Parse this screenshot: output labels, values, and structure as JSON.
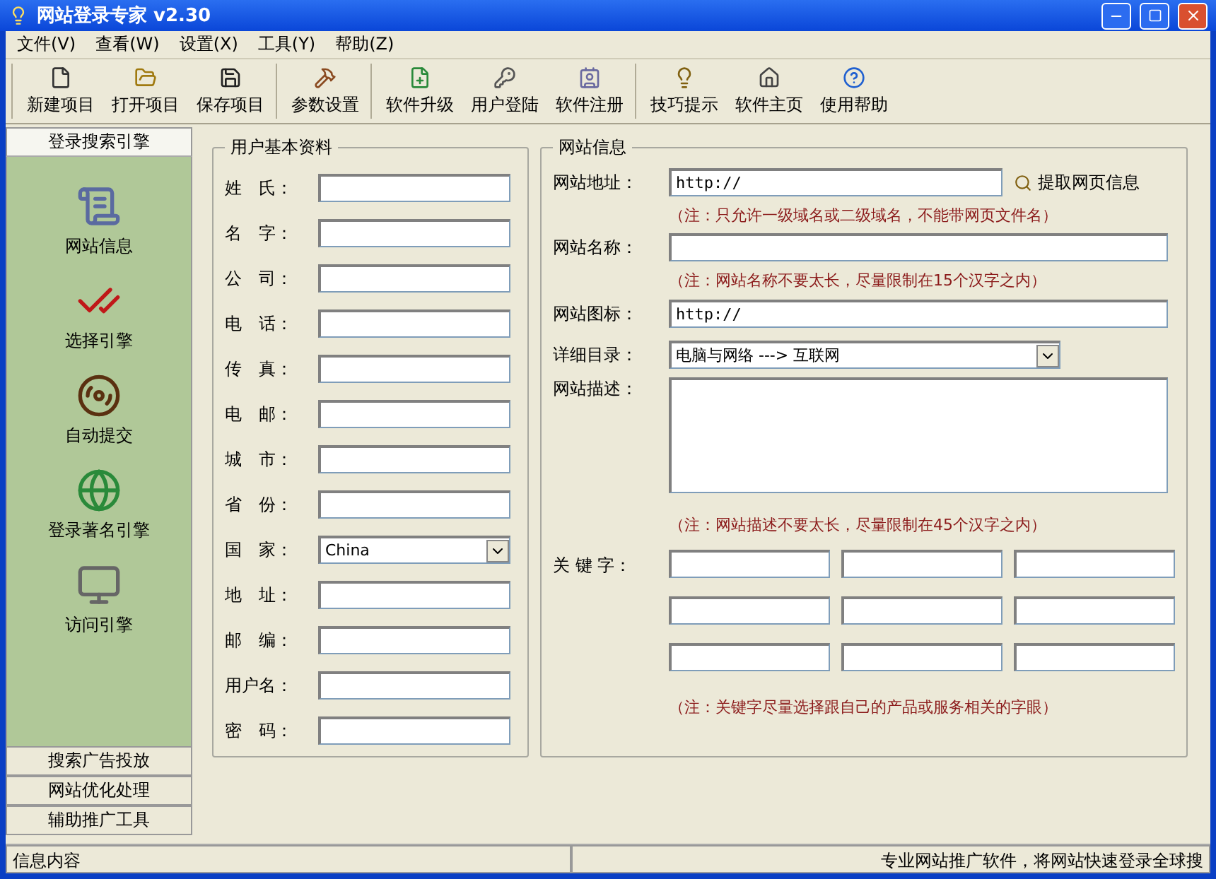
{
  "window": {
    "title": "网站登录专家 v2.30"
  },
  "menu": [
    "文件(V)",
    "查看(W)",
    "设置(X)",
    "工具(Y)",
    "帮助(Z)"
  ],
  "toolbar": [
    [
      {
        "label": "新建项目"
      },
      {
        "label": "打开项目"
      },
      {
        "label": "保存项目"
      }
    ],
    [
      {
        "label": "参数设置"
      }
    ],
    [
      {
        "label": "软件升级"
      },
      {
        "label": "用户登陆"
      },
      {
        "label": "软件注册"
      }
    ],
    [
      {
        "label": "技巧提示"
      },
      {
        "label": "软件主页"
      },
      {
        "label": "使用帮助"
      }
    ]
  ],
  "sidebar": {
    "top_section": {
      "label": "登录搜索引擎",
      "selected": true
    },
    "items": [
      {
        "label": "网站信息"
      },
      {
        "label": "选择引擎"
      },
      {
        "label": "自动提交"
      },
      {
        "label": "登录著名引擎"
      },
      {
        "label": "访问引擎"
      }
    ],
    "sections": [
      {
        "label": "搜索广告投放",
        "selected": false
      },
      {
        "label": "网站优化处理",
        "selected": false
      },
      {
        "label": "辅助推广工具",
        "selected": false
      }
    ]
  },
  "user_info": {
    "title": "用户基本资料",
    "fields": [
      {
        "label": "姓　氏：",
        "kind": "text"
      },
      {
        "label": "名　字：",
        "kind": "text"
      },
      {
        "label": "公　司：",
        "kind": "text"
      },
      {
        "label": "电　话：",
        "kind": "text"
      },
      {
        "label": "传　真：",
        "kind": "text"
      },
      {
        "label": "电　邮：",
        "kind": "text"
      },
      {
        "label": "城　市：",
        "kind": "text"
      },
      {
        "label": "省　份：",
        "kind": "text"
      },
      {
        "label": "国　家：",
        "kind": "select",
        "value": "China"
      },
      {
        "label": "地　址：",
        "kind": "text"
      },
      {
        "label": "邮　编：",
        "kind": "text"
      },
      {
        "label": "用户名：",
        "kind": "text"
      },
      {
        "label": "密　码：",
        "kind": "text"
      }
    ]
  },
  "site_info": {
    "title": "网站信息",
    "url": {
      "label": "网站地址：",
      "value": "http://",
      "note": "（注：只允许一级域名或二级域名，不能带网页文件名）"
    },
    "fetch_button": "提取网页信息",
    "name": {
      "label": "网站名称：",
      "note": "（注：网站名称不要太长，尽量限制在15个汉字之内）"
    },
    "icon_url": {
      "label": "网站图标：",
      "value": "http://"
    },
    "category": {
      "label": "详细目录：",
      "value": "电脑与网络 ---> 互联网"
    },
    "description": {
      "label": "网站描述：",
      "note": "（注：网站描述不要太长，尽量限制在45个汉字之内）"
    },
    "keywords": {
      "label": "关 键 字：",
      "fields": [
        {
          "kind": "text"
        },
        {
          "kind": "text"
        },
        {
          "kind": "text"
        },
        {
          "kind": "text"
        },
        {
          "kind": "text"
        },
        {
          "kind": "text"
        },
        {
          "kind": "text"
        },
        {
          "kind": "text"
        },
        {
          "kind": "text"
        }
      ],
      "note": "（注：关键字尽量选择跟自己的产品或服务相关的字眼）"
    }
  },
  "status_bar": [
    "信息内容",
    "专业网站推广软件，将网站快速登录全球搜"
  ]
}
